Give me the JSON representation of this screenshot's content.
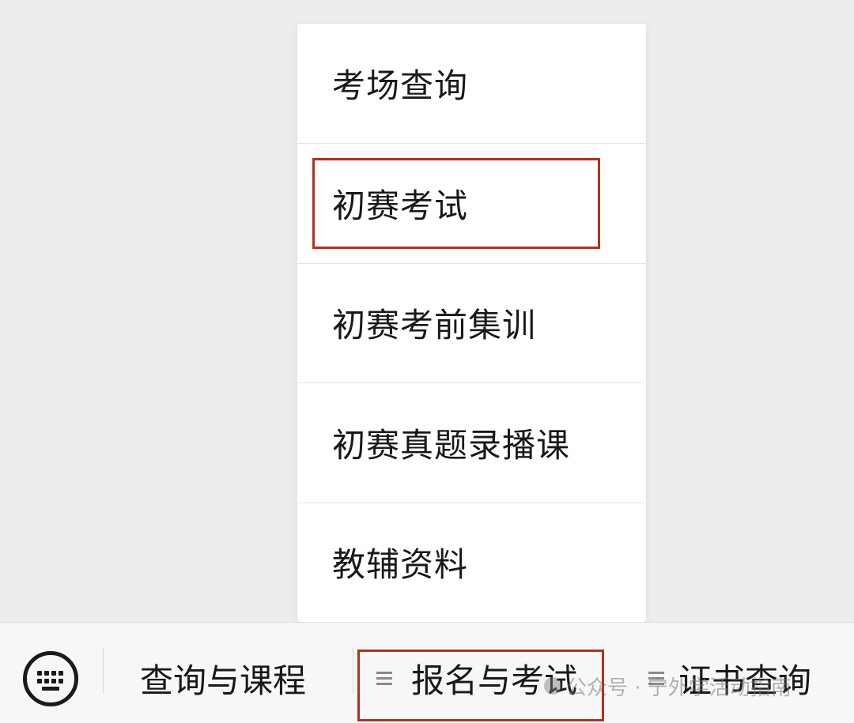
{
  "submenu": {
    "items": [
      {
        "label": "考场查询"
      },
      {
        "label": "初赛考试",
        "highlighted": true
      },
      {
        "label": "初赛考前集训"
      },
      {
        "label": "初赛真题录播课"
      },
      {
        "label": "教辅资料"
      }
    ]
  },
  "menubar": {
    "keyboard_icon": "keyboard-icon",
    "tabs": [
      {
        "label": "查询与课程",
        "has_menu_icon": false
      },
      {
        "label": "报名与考试",
        "has_menu_icon": true,
        "highlighted": true
      },
      {
        "label": "证书查询",
        "has_menu_icon": true
      }
    ]
  },
  "watermark": {
    "text": "公众号 · 宁外学活动指南"
  },
  "colors": {
    "highlight": "#b0321f",
    "background": "#ededed",
    "menu_background": "#ffffff",
    "text": "#191919"
  }
}
